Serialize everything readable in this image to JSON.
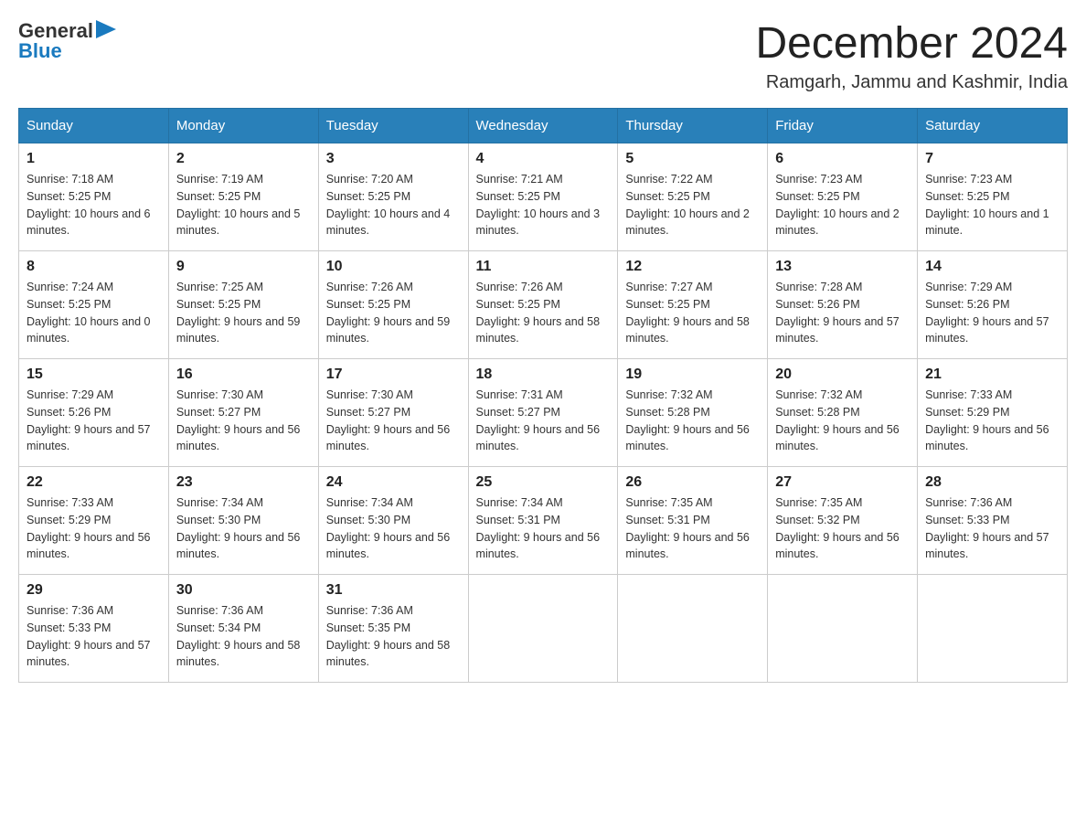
{
  "header": {
    "logo_text_black": "General",
    "logo_text_blue": "Blue",
    "month_title": "December 2024",
    "subtitle": "Ramgarh, Jammu and Kashmir, India"
  },
  "days_of_week": [
    "Sunday",
    "Monday",
    "Tuesday",
    "Wednesday",
    "Thursday",
    "Friday",
    "Saturday"
  ],
  "weeks": [
    [
      {
        "day": "1",
        "sunrise": "7:18 AM",
        "sunset": "5:25 PM",
        "daylight": "10 hours and 6 minutes."
      },
      {
        "day": "2",
        "sunrise": "7:19 AM",
        "sunset": "5:25 PM",
        "daylight": "10 hours and 5 minutes."
      },
      {
        "day": "3",
        "sunrise": "7:20 AM",
        "sunset": "5:25 PM",
        "daylight": "10 hours and 4 minutes."
      },
      {
        "day": "4",
        "sunrise": "7:21 AM",
        "sunset": "5:25 PM",
        "daylight": "10 hours and 3 minutes."
      },
      {
        "day": "5",
        "sunrise": "7:22 AM",
        "sunset": "5:25 PM",
        "daylight": "10 hours and 2 minutes."
      },
      {
        "day": "6",
        "sunrise": "7:23 AM",
        "sunset": "5:25 PM",
        "daylight": "10 hours and 2 minutes."
      },
      {
        "day": "7",
        "sunrise": "7:23 AM",
        "sunset": "5:25 PM",
        "daylight": "10 hours and 1 minute."
      }
    ],
    [
      {
        "day": "8",
        "sunrise": "7:24 AM",
        "sunset": "5:25 PM",
        "daylight": "10 hours and 0 minutes."
      },
      {
        "day": "9",
        "sunrise": "7:25 AM",
        "sunset": "5:25 PM",
        "daylight": "9 hours and 59 minutes."
      },
      {
        "day": "10",
        "sunrise": "7:26 AM",
        "sunset": "5:25 PM",
        "daylight": "9 hours and 59 minutes."
      },
      {
        "day": "11",
        "sunrise": "7:26 AM",
        "sunset": "5:25 PM",
        "daylight": "9 hours and 58 minutes."
      },
      {
        "day": "12",
        "sunrise": "7:27 AM",
        "sunset": "5:25 PM",
        "daylight": "9 hours and 58 minutes."
      },
      {
        "day": "13",
        "sunrise": "7:28 AM",
        "sunset": "5:26 PM",
        "daylight": "9 hours and 57 minutes."
      },
      {
        "day": "14",
        "sunrise": "7:29 AM",
        "sunset": "5:26 PM",
        "daylight": "9 hours and 57 minutes."
      }
    ],
    [
      {
        "day": "15",
        "sunrise": "7:29 AM",
        "sunset": "5:26 PM",
        "daylight": "9 hours and 57 minutes."
      },
      {
        "day": "16",
        "sunrise": "7:30 AM",
        "sunset": "5:27 PM",
        "daylight": "9 hours and 56 minutes."
      },
      {
        "day": "17",
        "sunrise": "7:30 AM",
        "sunset": "5:27 PM",
        "daylight": "9 hours and 56 minutes."
      },
      {
        "day": "18",
        "sunrise": "7:31 AM",
        "sunset": "5:27 PM",
        "daylight": "9 hours and 56 minutes."
      },
      {
        "day": "19",
        "sunrise": "7:32 AM",
        "sunset": "5:28 PM",
        "daylight": "9 hours and 56 minutes."
      },
      {
        "day": "20",
        "sunrise": "7:32 AM",
        "sunset": "5:28 PM",
        "daylight": "9 hours and 56 minutes."
      },
      {
        "day": "21",
        "sunrise": "7:33 AM",
        "sunset": "5:29 PM",
        "daylight": "9 hours and 56 minutes."
      }
    ],
    [
      {
        "day": "22",
        "sunrise": "7:33 AM",
        "sunset": "5:29 PM",
        "daylight": "9 hours and 56 minutes."
      },
      {
        "day": "23",
        "sunrise": "7:34 AM",
        "sunset": "5:30 PM",
        "daylight": "9 hours and 56 minutes."
      },
      {
        "day": "24",
        "sunrise": "7:34 AM",
        "sunset": "5:30 PM",
        "daylight": "9 hours and 56 minutes."
      },
      {
        "day": "25",
        "sunrise": "7:34 AM",
        "sunset": "5:31 PM",
        "daylight": "9 hours and 56 minutes."
      },
      {
        "day": "26",
        "sunrise": "7:35 AM",
        "sunset": "5:31 PM",
        "daylight": "9 hours and 56 minutes."
      },
      {
        "day": "27",
        "sunrise": "7:35 AM",
        "sunset": "5:32 PM",
        "daylight": "9 hours and 56 minutes."
      },
      {
        "day": "28",
        "sunrise": "7:36 AM",
        "sunset": "5:33 PM",
        "daylight": "9 hours and 57 minutes."
      }
    ],
    [
      {
        "day": "29",
        "sunrise": "7:36 AM",
        "sunset": "5:33 PM",
        "daylight": "9 hours and 57 minutes."
      },
      {
        "day": "30",
        "sunrise": "7:36 AM",
        "sunset": "5:34 PM",
        "daylight": "9 hours and 58 minutes."
      },
      {
        "day": "31",
        "sunrise": "7:36 AM",
        "sunset": "5:35 PM",
        "daylight": "9 hours and 58 minutes."
      },
      null,
      null,
      null,
      null
    ]
  ]
}
